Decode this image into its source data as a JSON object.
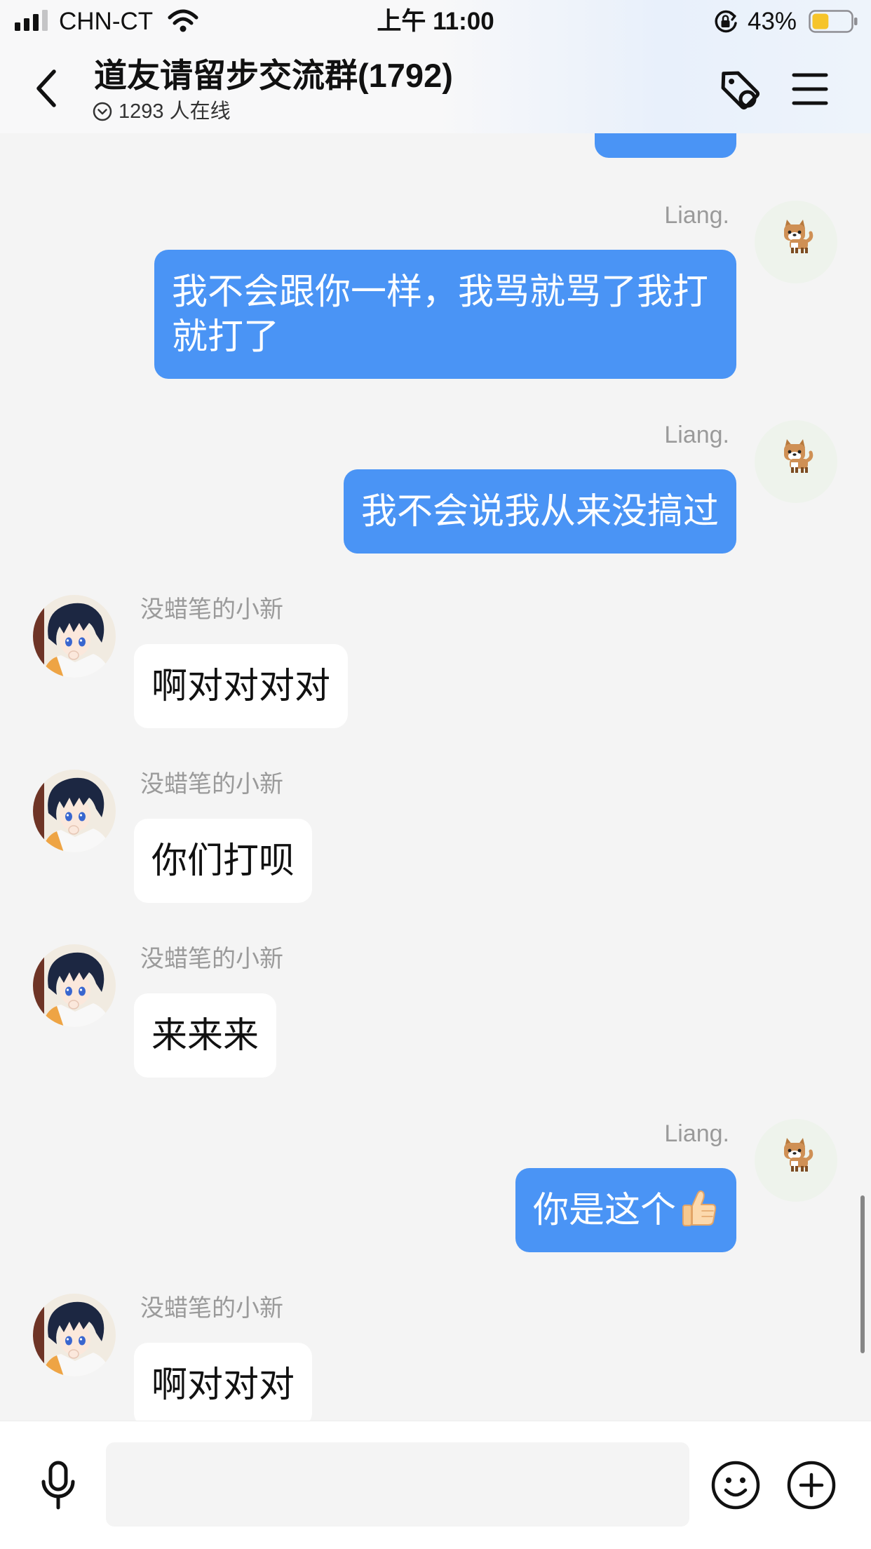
{
  "status_bar": {
    "carrier": "CHN-CT",
    "time": "上午 11:00",
    "battery_text": "43%",
    "battery_level": 0.43,
    "signal_level": 3,
    "signal_max": 4,
    "icons": [
      "signal-icon",
      "wifi-icon",
      "rotation-lock-icon",
      "battery-icon"
    ]
  },
  "header": {
    "back_icon": "chevron-left-icon",
    "title": "道友请留步交流群(1792)",
    "online_icon": "chevron-circle-icon",
    "online_text": "1293 人在线",
    "action_icons": [
      "tag-icon",
      "menu-icon"
    ]
  },
  "messages": [
    {
      "side": "right",
      "sender": "Liang.",
      "avatar": "shiba-dog-avatar",
      "text": "我不会跟你一样，我骂就骂了我打就打了"
    },
    {
      "side": "right",
      "sender": "Liang.",
      "avatar": "shiba-dog-avatar",
      "text": "我不会说我从来没搞过"
    },
    {
      "side": "left",
      "sender": "没蜡笔的小新",
      "avatar": "anime-boy-avatar",
      "text": "啊对对对对"
    },
    {
      "side": "left",
      "sender": "没蜡笔的小新",
      "avatar": "anime-boy-avatar",
      "text": "你们打呗"
    },
    {
      "side": "left",
      "sender": "没蜡笔的小新",
      "avatar": "anime-boy-avatar",
      "text": "来来来"
    },
    {
      "side": "right",
      "sender": "Liang.",
      "avatar": "shiba-dog-avatar",
      "text": "你是这个",
      "emoji_icon": "thumbs-up-icon"
    },
    {
      "side": "left",
      "sender": "没蜡笔的小新",
      "avatar": "anime-boy-avatar",
      "text": "啊对对对"
    }
  ],
  "input_bar": {
    "value": "",
    "icons": [
      "microphone-icon",
      "emoji-icon",
      "plus-circle-icon"
    ]
  },
  "colors": {
    "outgoing_bubble": "#4a94f5",
    "incoming_bubble": "#ffffff",
    "chat_background": "#f4f4f4",
    "sender_name": "#9a9a9a",
    "battery_fill": "#f6c42a"
  }
}
